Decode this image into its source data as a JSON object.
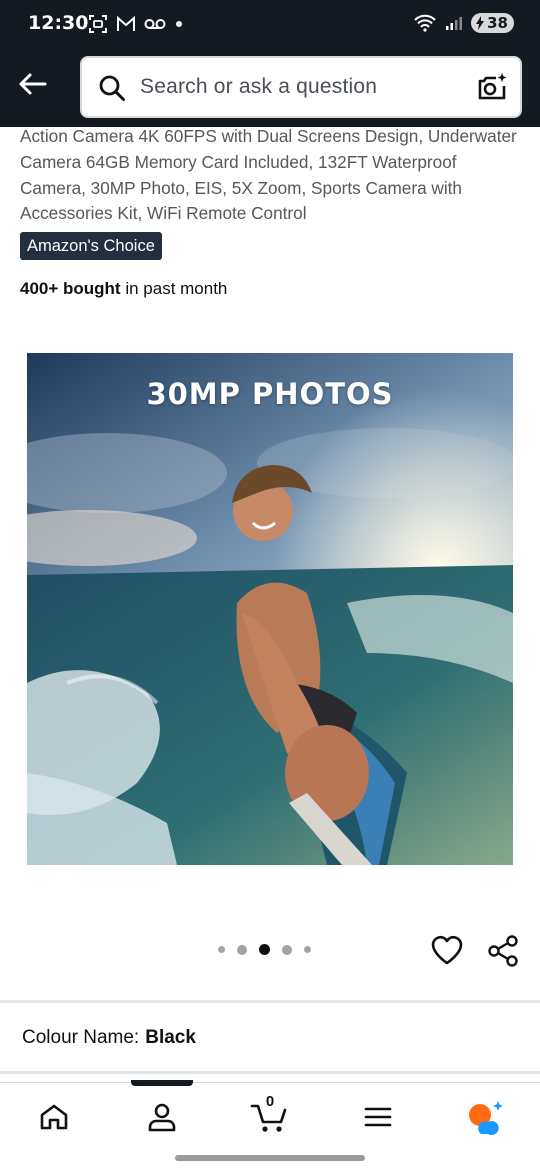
{
  "status_bar": {
    "time": "12:30",
    "battery": "38",
    "left_icons": [
      "screenshot-icon",
      "gmail-icon",
      "voicemail-icon",
      "dot-icon"
    ],
    "right_icons": [
      "wifi-icon",
      "signal-icon",
      "battery-icon"
    ]
  },
  "header": {
    "search_placeholder": "Search or ask a question",
    "icons": [
      "back-arrow-icon",
      "search-icon",
      "camera-search-icon"
    ]
  },
  "product": {
    "title": "Action Camera 4K 60FPS with Dual Screens Design, Underwater Camera 64GB Memory Card Included, 132FT Waterproof Camera, 30MP Photo, EIS, 5X Zoom, Sports Camera with Accessories Kit, WiFi Remote Control",
    "badge": "Amazon's Choice",
    "bought_bold": "400+ bought",
    "bought_rest": " in past month",
    "image_caption": "30MP PHOTOS",
    "carousel": {
      "total": 5,
      "active_index": 2
    },
    "colour_label": "Colour Name:",
    "colour_value": "Black"
  },
  "bottom_nav": {
    "items": [
      "home-icon",
      "account-icon",
      "cart-icon",
      "menu-icon",
      "rufus-ai-icon"
    ],
    "cart_count": "0",
    "active_index": 1
  },
  "colors": {
    "header_bg": "#131a22",
    "badge_bg": "#232f3e",
    "ai_orange": "#ff6a13",
    "ai_blue": "#1a98ff"
  }
}
